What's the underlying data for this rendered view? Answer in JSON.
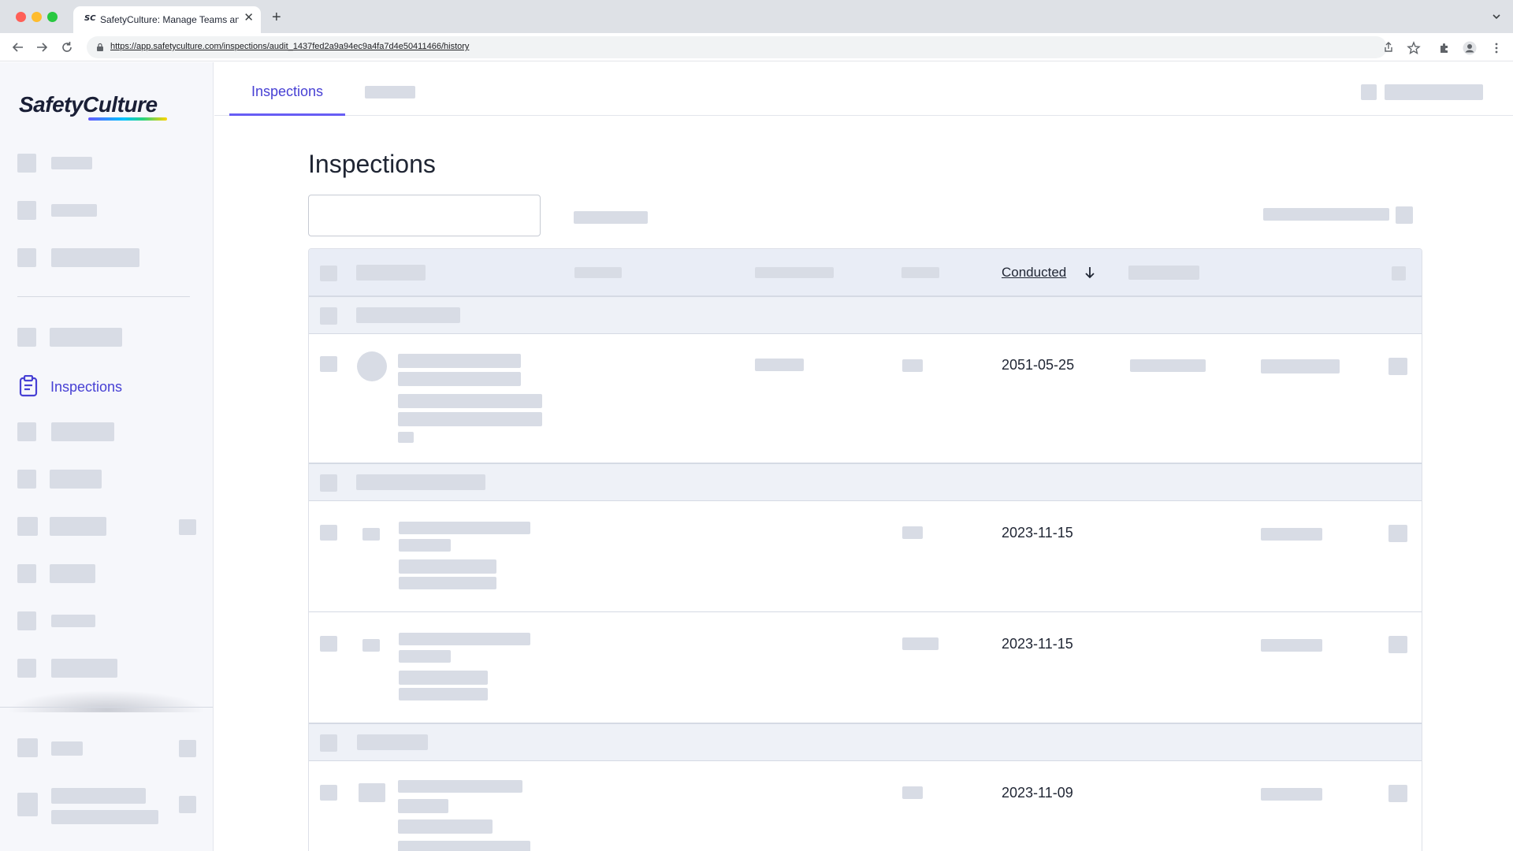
{
  "browser": {
    "tab_title": "SafetyCulture: Manage Teams and ...",
    "tab_favicon": "SC",
    "url": "https://app.safetyculture.com/inspections/audit_1437fed2a9a94ec9a4fa7d4e50411466/history"
  },
  "sidebar": {
    "logo_text": "SafetyCulture",
    "active_item": {
      "label": "Inspections",
      "icon": "clipboard-icon"
    }
  },
  "topnav": {
    "active_tab": "Inspections"
  },
  "main": {
    "title": "Inspections",
    "search": {
      "placeholder": "",
      "value": ""
    },
    "table": {
      "sort_column": "Conducted",
      "sort_direction": "descending",
      "rows": [
        {
          "conducted": "2051-05-25"
        },
        {
          "conducted": "2023-11-15"
        },
        {
          "conducted": "2023-11-15"
        },
        {
          "conducted": "2023-11-09"
        }
      ]
    }
  },
  "colors": {
    "accent": "#4740d4",
    "skeleton": "#d8dce5",
    "header_bg": "#e9edf6",
    "sidebar_bg": "#f6f7fb"
  }
}
